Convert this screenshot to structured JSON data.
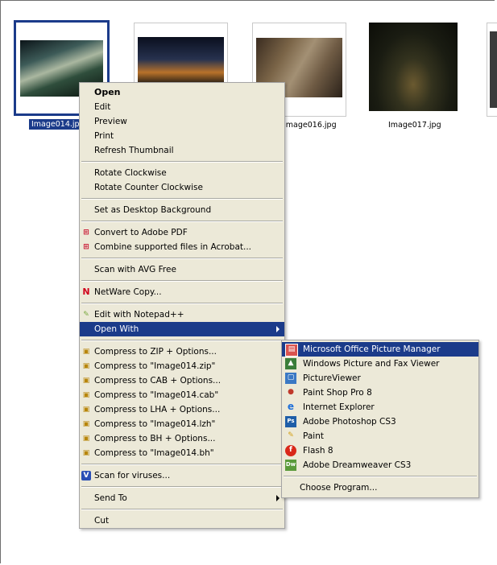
{
  "thumbnails": [
    {
      "caption": "Image014.jpg",
      "selected": true
    },
    {
      "caption": "",
      "selected": false
    },
    {
      "caption": "Image016.jpg",
      "selected": false
    },
    {
      "caption": "Image017.jpg",
      "selected": false
    }
  ],
  "context_menu": {
    "open": "Open",
    "edit": "Edit",
    "preview": "Preview",
    "print": "Print",
    "refresh_thumbnail": "Refresh Thumbnail",
    "rotate_cw": "Rotate Clockwise",
    "rotate_ccw": "Rotate Counter Clockwise",
    "set_desktop": "Set as Desktop Background",
    "convert_pdf": "Convert to Adobe PDF",
    "combine_acrobat": "Combine supported files in Acrobat...",
    "scan_avg": "Scan with AVG Free",
    "netware_copy": "NetWare Copy...",
    "edit_notepad": "Edit with Notepad++",
    "open_with": "Open With",
    "compress_zip_options": "Compress to ZIP + Options...",
    "compress_zip": "Compress to \"Image014.zip\"",
    "compress_cab_options": "Compress to CAB + Options...",
    "compress_cab": "Compress to \"Image014.cab\"",
    "compress_lha_options": "Compress to LHA + Options...",
    "compress_lzh": "Compress to \"Image014.lzh\"",
    "compress_bh_options": "Compress to BH + Options...",
    "compress_bh": "Compress to \"Image014.bh\"",
    "scan_viruses": "Scan for viruses...",
    "send_to": "Send To",
    "cut": "Cut"
  },
  "open_with_menu": {
    "items": [
      "Microsoft Office Picture Manager",
      "Windows Picture and Fax Viewer",
      "PictureViewer",
      "Paint Shop Pro 8",
      "Internet Explorer",
      "Adobe Photoshop CS3",
      "Paint",
      "Flash 8",
      "Adobe Dreamweaver CS3"
    ],
    "choose_program": "Choose Program..."
  },
  "colors": {
    "highlight": "#1b3b8a",
    "menu_bg": "#ece9d8"
  }
}
